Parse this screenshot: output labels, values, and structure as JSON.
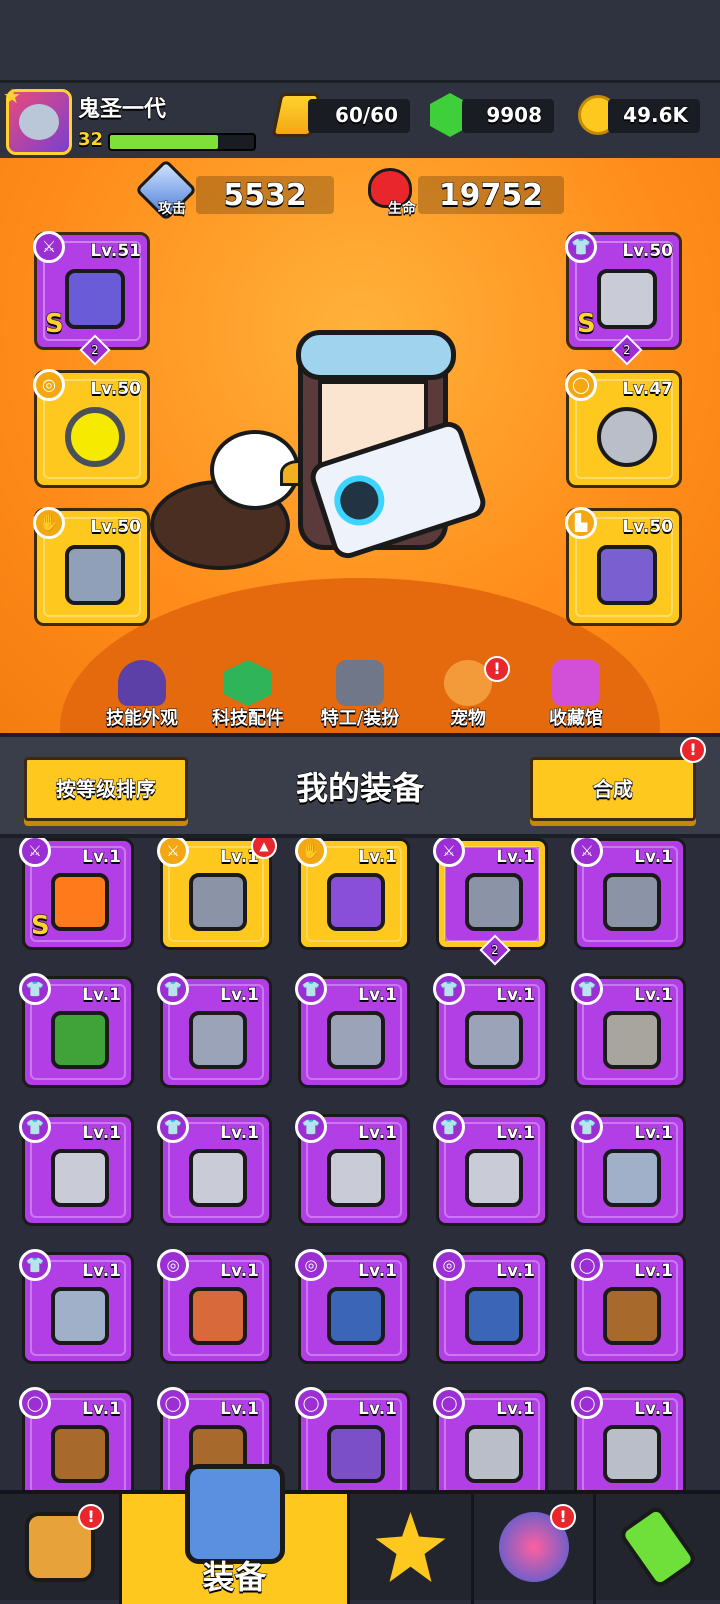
{
  "player": {
    "name": "鬼圣一代",
    "level": "32",
    "xp_fraction": 0.75
  },
  "resources": {
    "energy": "60/60",
    "gems": "9908",
    "gold": "49.6K"
  },
  "stats": {
    "attack_label": "攻击",
    "attack": "5532",
    "hp_label": "生命",
    "hp": "19752"
  },
  "equipped": {
    "left": [
      {
        "level": "Lv.51",
        "type_icon": "weapon-icon",
        "grade": "S",
        "stars": "2",
        "color": "purple"
      },
      {
        "level": "Lv.50",
        "type_icon": "necklace-icon",
        "color": "yellow"
      },
      {
        "level": "Lv.50",
        "type_icon": "glove-icon",
        "color": "yellow"
      }
    ],
    "right": [
      {
        "level": "Lv.50",
        "type_icon": "armor-icon",
        "grade": "S",
        "stars": "2",
        "color": "purple"
      },
      {
        "level": "Lv.47",
        "type_icon": "belt-icon",
        "color": "yellow"
      },
      {
        "level": "Lv.50",
        "type_icon": "boot-icon",
        "color": "yellow"
      }
    ]
  },
  "subnav": [
    {
      "label": "技能外观"
    },
    {
      "label": "科技配件"
    },
    {
      "label": "特工/装扮"
    },
    {
      "label": "宠物",
      "badge": "!"
    },
    {
      "label": "收藏馆"
    }
  ],
  "section": {
    "sort_label": "按等级排序",
    "title": "我的装备",
    "merge_label": "合成",
    "merge_badge": "!"
  },
  "inventory": [
    {
      "level": "Lv.1",
      "color": "purple",
      "type": "weapon",
      "grade": "S",
      "art": "#ff7a1a"
    },
    {
      "level": "Lv.1",
      "color": "yellow",
      "type": "weapon",
      "new": true,
      "art": "#8b93a6"
    },
    {
      "level": "Lv.1",
      "color": "yellow",
      "type": "glove",
      "art": "#8a4fd8"
    },
    {
      "level": "Lv.1",
      "color": "purple",
      "type": "weapon",
      "stars": "2",
      "framed": true,
      "art": "#8b93a6"
    },
    {
      "level": "Lv.1",
      "color": "purple",
      "type": "weapon",
      "art": "#8b93a6"
    },
    {
      "level": "Lv.1",
      "color": "purple",
      "type": "armor",
      "art": "#3fa33a"
    },
    {
      "level": "Lv.1",
      "color": "purple",
      "type": "armor",
      "art": "#9aa3b8"
    },
    {
      "level": "Lv.1",
      "color": "purple",
      "type": "armor",
      "art": "#9aa3b8"
    },
    {
      "level": "Lv.1",
      "color": "purple",
      "type": "armor",
      "art": "#9aa3b8"
    },
    {
      "level": "Lv.1",
      "color": "purple",
      "type": "armor",
      "art": "#a7a59d"
    },
    {
      "level": "Lv.1",
      "color": "purple",
      "type": "armor",
      "art": "#c9ccd6"
    },
    {
      "level": "Lv.1",
      "color": "purple",
      "type": "armor",
      "art": "#c9ccd6"
    },
    {
      "level": "Lv.1",
      "color": "purple",
      "type": "armor",
      "art": "#c9ccd6"
    },
    {
      "level": "Lv.1",
      "color": "purple",
      "type": "armor",
      "art": "#c9ccd6"
    },
    {
      "level": "Lv.1",
      "color": "purple",
      "type": "armor",
      "art": "#9fb0c8"
    },
    {
      "level": "Lv.1",
      "color": "purple",
      "type": "armor",
      "art": "#9fb0c8"
    },
    {
      "level": "Lv.1",
      "color": "purple",
      "type": "necklace",
      "art": "#d7693a"
    },
    {
      "level": "Lv.1",
      "color": "purple",
      "type": "necklace",
      "art": "#3b66b8"
    },
    {
      "level": "Lv.1",
      "color": "purple",
      "type": "necklace",
      "art": "#3b66b8"
    },
    {
      "level": "Lv.1",
      "color": "purple",
      "type": "belt",
      "art": "#a86a2c"
    },
    {
      "level": "Lv.1",
      "color": "purple",
      "type": "belt",
      "art": "#a86a2c"
    },
    {
      "level": "Lv.1",
      "color": "purple",
      "type": "belt",
      "art": "#a86a2c"
    },
    {
      "level": "Lv.1",
      "color": "purple",
      "type": "belt",
      "art": "#7b4fc8"
    },
    {
      "level": "Lv.1",
      "color": "purple",
      "type": "belt",
      "art": "#b9bec9"
    },
    {
      "level": "Lv.1",
      "color": "purple",
      "type": "belt",
      "art": "#b9bec9"
    }
  ],
  "bottomnav": [
    {
      "icon": "shop-icon",
      "badge": "!"
    },
    {
      "icon": "equipment-icon",
      "label": "装备",
      "active": true
    },
    {
      "icon": "battle-star-icon"
    },
    {
      "icon": "egg-icon",
      "badge": "!"
    },
    {
      "icon": "dna-icon"
    }
  ],
  "colors": {
    "purple": "#b23fe6",
    "yellow": "#ffc81e",
    "arena": "#ff8c1a",
    "xp": "#7fe03a"
  }
}
